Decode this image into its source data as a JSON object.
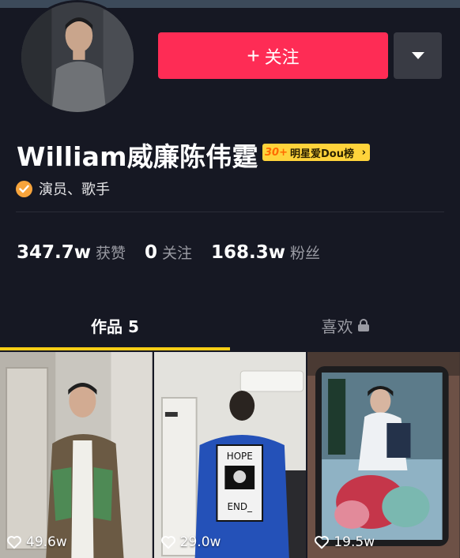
{
  "profile": {
    "name": "William威廉陈伟霆",
    "rank_number": "30+",
    "rank_label": "明星爱Dou榜",
    "rank_arrow": "›",
    "verified_text": "演员、歌手"
  },
  "actions": {
    "follow_plus": "+",
    "follow_label": "关注"
  },
  "stats": [
    {
      "value": "347.7w",
      "label": "获赞"
    },
    {
      "value": "0",
      "label": "关注"
    },
    {
      "value": "168.3w",
      "label": "粉丝"
    }
  ],
  "tabs": {
    "works_label": "作品 5",
    "likes_label": "喜欢"
  },
  "videos": [
    {
      "likes": "49.6w",
      "icon": "heart-outline-icon"
    },
    {
      "likes": "29.0w",
      "icon": "heart-outline-icon"
    },
    {
      "likes": "19.5w",
      "icon": "heart-outline-icon"
    }
  ],
  "video2_shirt_text": {
    "top": "HOPE",
    "bottom": "END_"
  },
  "colors": {
    "background": "#161823",
    "follow_button": "#fe2c55",
    "rank_badge": "#ffd33b",
    "tab_underline": "#face15",
    "verified_badge": "#f7a43c"
  }
}
